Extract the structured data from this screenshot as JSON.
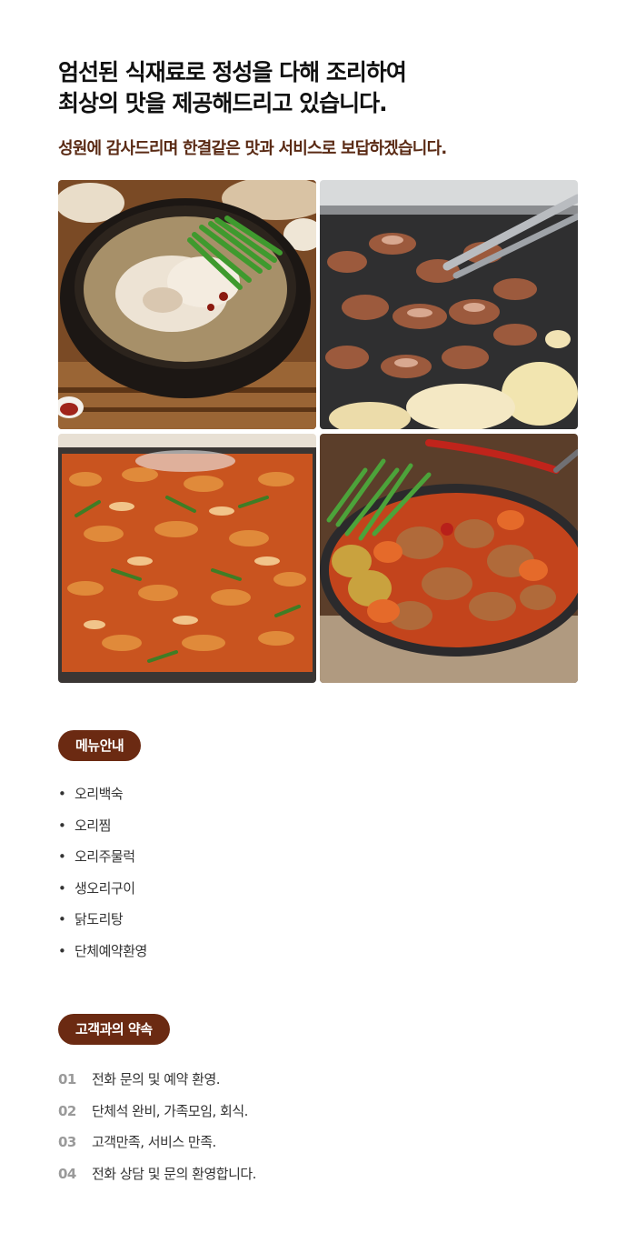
{
  "headline": {
    "line1": "엄선된 식재료로 정성을 다해 조리하여",
    "line2": "최상의 맛을 제공해드리고 있습니다."
  },
  "subheadline": "성원에 감사드리며 한결같은 맛과 서비스로 보답하겠습니다.",
  "menu_section": {
    "title": "메뉴안내",
    "items": [
      "오리백숙",
      "오리찜",
      "오리주물럭",
      "생오리구이",
      "닭도리탕",
      "단체예약환영"
    ]
  },
  "promise_section": {
    "title": "고객과의 약속",
    "items": [
      {
        "num": "01",
        "text": "전화 문의 및 예약 환영."
      },
      {
        "num": "02",
        "text": "단체석 완비, 가족모임, 회식."
      },
      {
        "num": "03",
        "text": "고객만족, 서비스 만족."
      },
      {
        "num": "04",
        "text": "전화 상담 및 문의 환영합니다."
      }
    ]
  },
  "colors": {
    "accent": "#6b2a12",
    "subheadline": "#5a2a14",
    "number": "#9a9a9a"
  }
}
